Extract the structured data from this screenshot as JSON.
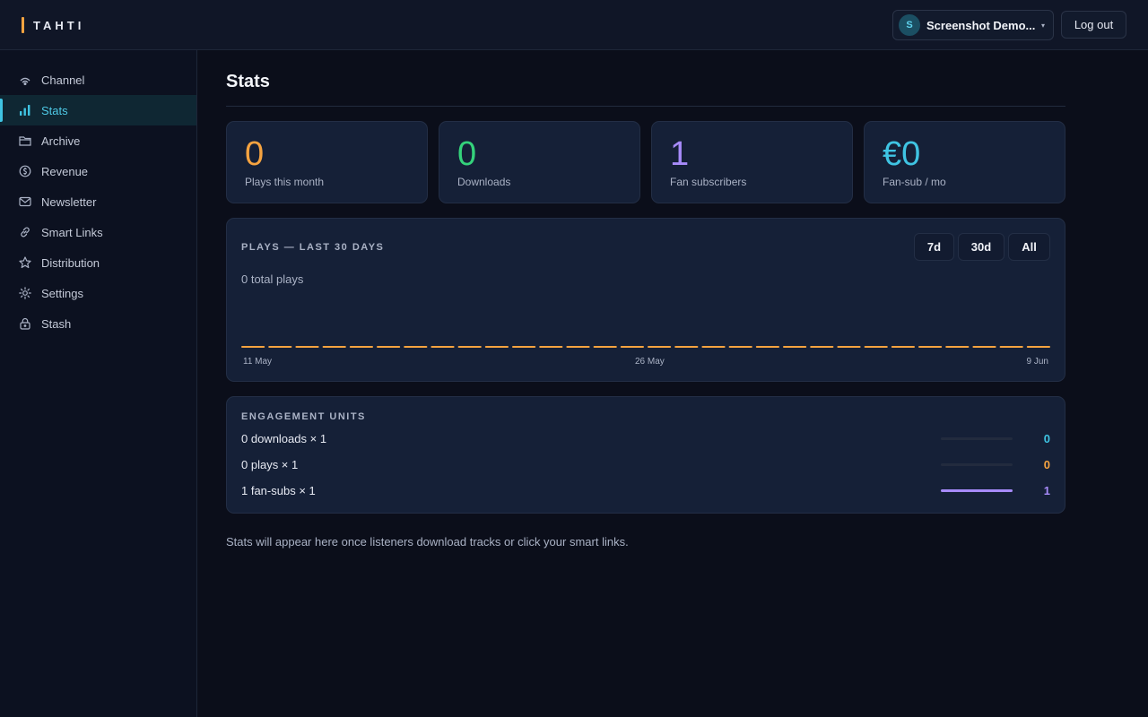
{
  "app": {
    "logo_text": "TAHTI"
  },
  "header": {
    "avatar_initial": "S",
    "account_name": "Screenshot Demo...",
    "logout_label": "Log out"
  },
  "sidebar": {
    "items": [
      {
        "label": "Channel",
        "icon": "broadcast-icon"
      },
      {
        "label": "Stats",
        "icon": "bar-chart-icon",
        "active": true
      },
      {
        "label": "Archive",
        "icon": "folder-icon"
      },
      {
        "label": "Revenue",
        "icon": "coin-icon"
      },
      {
        "label": "Newsletter",
        "icon": "mail-icon"
      },
      {
        "label": "Smart Links",
        "icon": "link-icon"
      },
      {
        "label": "Distribution",
        "icon": "star-icon"
      },
      {
        "label": "Settings",
        "icon": "gear-icon"
      },
      {
        "label": "Stash",
        "icon": "lock-icon"
      }
    ]
  },
  "main": {
    "title": "Stats",
    "stats": [
      {
        "value": "0",
        "label": "Plays this month",
        "color": "#f5a340"
      },
      {
        "value": "0",
        "label": "Downloads",
        "color": "#34d27b"
      },
      {
        "value": "1",
        "label": "Fan subscribers",
        "color": "#a78bfa"
      },
      {
        "value": "€0",
        "label": "Fan-sub / mo",
        "color": "#3fc4e3"
      }
    ],
    "plays_panel": {
      "title": "PLAYS — LAST 30 DAYS",
      "ranges": [
        "7d",
        "30d",
        "All"
      ],
      "total_text": "0 total plays"
    },
    "engagement": {
      "title": "ENGAGEMENT UNITS",
      "rows": [
        {
          "label": "0 downloads × 1",
          "value": "0",
          "fraction": 0,
          "color": "#3fc4e3"
        },
        {
          "label": "0 plays × 1",
          "value": "0",
          "fraction": 0,
          "color": "#f5a340"
        },
        {
          "label": "1 fan-subs × 1",
          "value": "1",
          "fraction": 1,
          "color": "#a78bfa"
        }
      ]
    },
    "footer_note": "Stats will appear here once listeners download tracks or click your smart links."
  },
  "chart_data": {
    "type": "bar",
    "title": "PLAYS — LAST 30 DAYS",
    "x_tick_labels": [
      "11 May",
      "26 May",
      "9 Jun"
    ],
    "values": [
      0,
      0,
      0,
      0,
      0,
      0,
      0,
      0,
      0,
      0,
      0,
      0,
      0,
      0,
      0,
      0,
      0,
      0,
      0,
      0,
      0,
      0,
      0,
      0,
      0,
      0,
      0,
      0,
      0,
      0
    ],
    "color": "#f5a340"
  }
}
